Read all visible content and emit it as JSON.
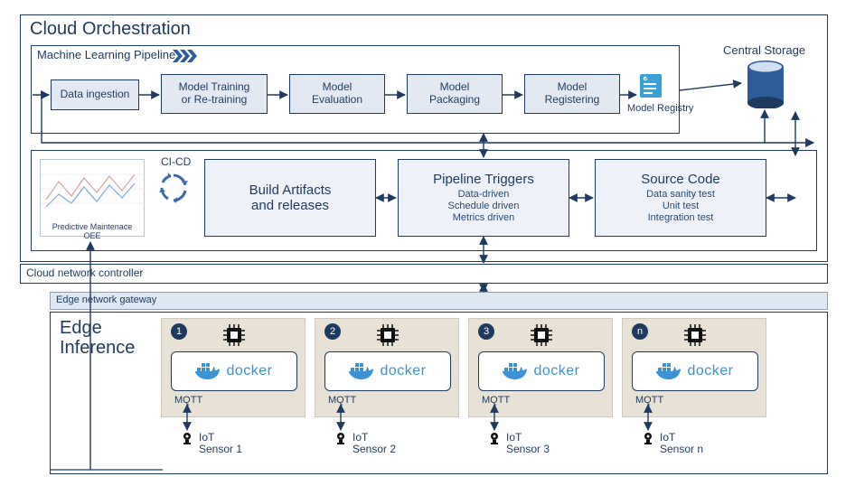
{
  "cloud": {
    "title": "Cloud Orchestration",
    "pipeline_label": "Machine Learning Pipeline",
    "stages": {
      "ingestion": "Data ingestion",
      "training": "Model Training\nor Re-training",
      "evaluation": "Model\nEvaluation",
      "packaging": "Model\nPackaging",
      "registering": "Model\nRegistering",
      "registry": "Model Registry"
    },
    "central_storage": "Central Storage",
    "cicd": "CI-CD",
    "pm_oee": "Predictive Maintenace OEE",
    "build": {
      "t1a": "Build Artifacts",
      "t1b": "and releases"
    },
    "triggers": {
      "t1": "Pipeline Triggers",
      "l1": "Data-driven",
      "l2": "Schedule driven",
      "l3": "Metrics driven"
    },
    "source": {
      "t1": "Source Code",
      "l1": "Data sanity test",
      "l2": "Unit test",
      "l3": "Integration test"
    },
    "cnc": "Cloud network controller"
  },
  "edge": {
    "gateway": "Edge network gateway",
    "title": "Edge\nInference",
    "docker": "docker",
    "mqtt": "MQTT",
    "nodes": [
      {
        "badge": "1",
        "iot": "IoT\nSensor 1"
      },
      {
        "badge": "2",
        "iot": "IoT\nSensor 2"
      },
      {
        "badge": "3",
        "iot": "IoT\nSensor 3"
      },
      {
        "badge": "n",
        "iot": "IoT\nSensor n"
      }
    ]
  },
  "chart_data": {
    "type": "diagram",
    "title": "Cloud Orchestration and Edge Inference architecture",
    "components": {
      "cloud_orchestration": {
        "machine_learning_pipeline": [
          "Data ingestion",
          "Model Training or Re-training",
          "Model Evaluation",
          "Model Packaging",
          "Model Registering",
          "Model Registry"
        ],
        "central_storage": true,
        "ci_cd_row": {
          "predictive_maintenance_oee_dashboard": true,
          "ci_cd_cycle": true,
          "blocks": [
            "Build Artifacts and releases",
            "Pipeline Triggers (Data-driven, Schedule driven, Metrics driven)",
            "Source Code (Data sanity test, Unit test, Integration test)"
          ]
        },
        "cloud_network_controller": true
      },
      "edge": {
        "edge_network_gateway": true,
        "edge_inference_nodes": 4,
        "node_labels": [
          "1",
          "2",
          "3",
          "n"
        ],
        "per_node": {
          "compute_chip": true,
          "docker_container": true,
          "protocol": "MQTT",
          "iot_sensor": true
        }
      }
    },
    "flows": [
      {
        "from": "Data ingestion",
        "to": "Model Training or Re-training",
        "dir": "uni"
      },
      {
        "from": "Model Training or Re-training",
        "to": "Model Evaluation",
        "dir": "uni"
      },
      {
        "from": "Model Evaluation",
        "to": "Model Packaging",
        "dir": "uni"
      },
      {
        "from": "Model Packaging",
        "to": "Model Registering",
        "dir": "uni"
      },
      {
        "from": "Model Registering",
        "to": "Model Registry",
        "dir": "uni"
      },
      {
        "from": "Model Registry",
        "to": "Central Storage",
        "dir": "uni"
      },
      {
        "from": "Central Storage",
        "to": "CI-CD row",
        "dir": "bi"
      },
      {
        "from": "Central Storage",
        "to": "ML Pipeline (feedback)",
        "dir": "bi"
      },
      {
        "from": "Build Artifacts and releases",
        "to": "Pipeline Triggers",
        "dir": "bi"
      },
      {
        "from": "Pipeline Triggers",
        "to": "Source Code",
        "dir": "bi"
      },
      {
        "from": "Pipeline Triggers",
        "to": "Cloud network controller",
        "dir": "bi"
      },
      {
        "from": "Cloud network controller",
        "to": "Edge network gateway",
        "dir": "bi"
      },
      {
        "from": "Edge nodes (MQTT)",
        "to": "IoT Sensors",
        "dir": "bi"
      },
      {
        "from": "IoT Sensor feedback",
        "to": "Predictive Maintenance OEE",
        "dir": "uni"
      }
    ]
  }
}
